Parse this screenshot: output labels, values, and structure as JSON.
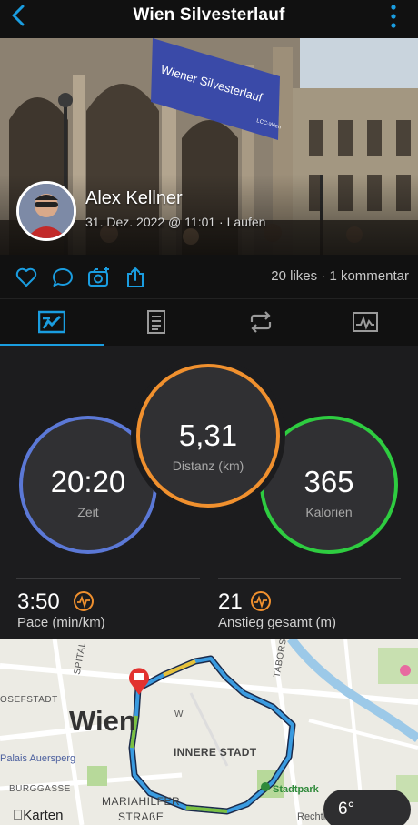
{
  "header": {
    "title": "Wien Silvesterlauf"
  },
  "hero": {
    "banner_text": "Wiener Silvesterlauf",
    "banner_subtext": "LCC-Wien",
    "user_name": "Alex Kellner",
    "date_info": "31. Dez. 2022 @ 11:01 · Laufen"
  },
  "social": {
    "likes_comments": "20 likes · 1 kommentar"
  },
  "stats": {
    "time": {
      "value": "20:20",
      "label": "Zeit"
    },
    "distance": {
      "value": "5,31",
      "label": "Distanz (km)"
    },
    "calories": {
      "value": "365",
      "label": "Kalorien"
    },
    "pace": {
      "value": "3:50",
      "label": "Pace (min/km)"
    },
    "ascent": {
      "value": "21",
      "label": "Anstieg gesamt (m)"
    }
  },
  "map": {
    "city_label": "Wien",
    "district_label": "INNERE STADT",
    "park_label": "Stadtpark",
    "poi_label": "Palais Auersperg",
    "street_labels": [
      "SPITAL",
      "TABORS",
      "OSEFSTADT",
      "BURGGASSE",
      "MARIAHILFER",
      "STRAßE",
      "W"
    ],
    "brand": "Karten",
    "legal": "Rechtl."
  },
  "weather": {
    "temperature": "6°"
  },
  "colors": {
    "accent": "#1a9de0",
    "time_ring": "#5b78d6",
    "distance_ring": "#f0902e",
    "calories_ring": "#2ecc40",
    "metric_icon": "#f0902e"
  }
}
